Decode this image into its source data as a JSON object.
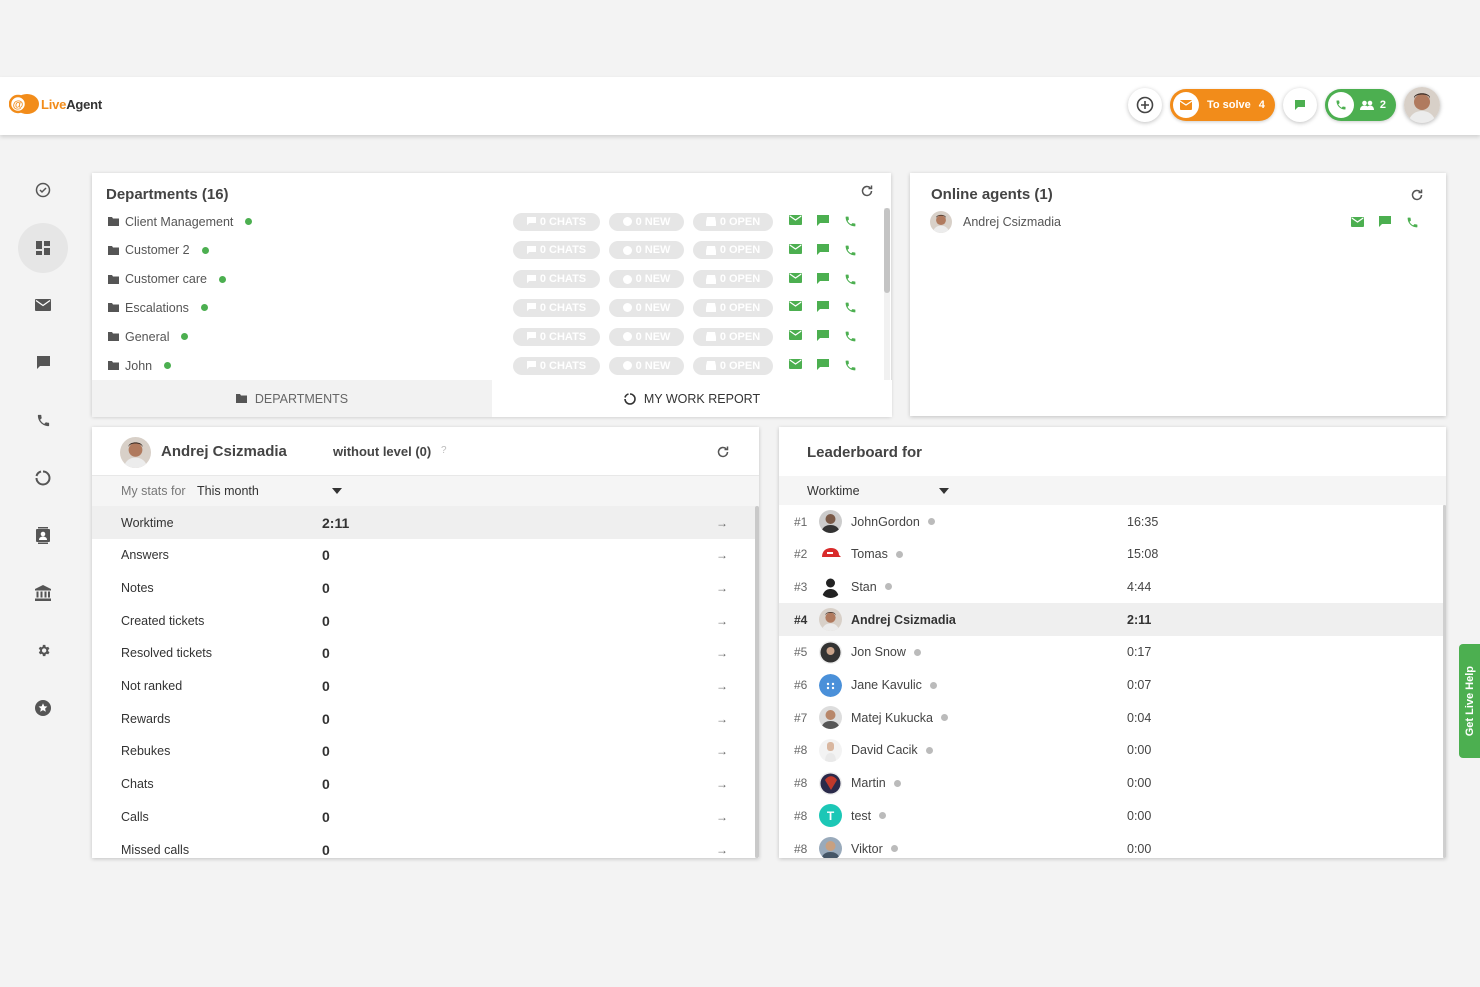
{
  "header": {
    "logo_live": "Live",
    "logo_agent": "Agent",
    "to_solve_label": "To solve",
    "to_solve_count": "4",
    "agents_online_count": "2"
  },
  "departments": {
    "title": "Departments (16)",
    "items": [
      {
        "name": "Client Management",
        "chats": "0 CHATS",
        "new": "0 NEW",
        "open": "0 OPEN"
      },
      {
        "name": "Customer 2",
        "chats": "0 CHATS",
        "new": "0 NEW",
        "open": "0 OPEN"
      },
      {
        "name": "Customer care",
        "chats": "0 CHATS",
        "new": "0 NEW",
        "open": "0 OPEN"
      },
      {
        "name": "Escalations",
        "chats": "0 CHATS",
        "new": "0 NEW",
        "open": "0 OPEN"
      },
      {
        "name": "General",
        "chats": "0 CHATS",
        "new": "0 NEW",
        "open": "0 OPEN"
      },
      {
        "name": "John",
        "chats": "0 CHATS",
        "new": "0 NEW",
        "open": "0 OPEN"
      }
    ],
    "tab_departments": "DEPARTMENTS",
    "tab_work_report": "MY WORK REPORT"
  },
  "online_agents": {
    "title": "Online agents (1)",
    "agents": [
      {
        "name": "Andrej Csizmadia"
      }
    ]
  },
  "my_stats": {
    "agent_name": "Andrej Csizmadia",
    "level": "without level (0)",
    "help_mark": "?",
    "stats_for_label": "My stats for",
    "period": "This month",
    "rows": [
      {
        "label": "Worktime",
        "value": "2:11"
      },
      {
        "label": "Answers",
        "value": "0"
      },
      {
        "label": "Notes",
        "value": "0"
      },
      {
        "label": "Created tickets",
        "value": "0"
      },
      {
        "label": "Resolved tickets",
        "value": "0"
      },
      {
        "label": "Not ranked",
        "value": "0"
      },
      {
        "label": "Rewards",
        "value": "0"
      },
      {
        "label": "Rebukes",
        "value": "0"
      },
      {
        "label": "Chats",
        "value": "0"
      },
      {
        "label": "Calls",
        "value": "0"
      },
      {
        "label": "Missed calls",
        "value": "0"
      }
    ]
  },
  "leaderboard": {
    "title": "Leaderboard for",
    "metric": "Worktime",
    "rows": [
      {
        "rank": "#1",
        "name": "JohnGordon",
        "value": "16:35"
      },
      {
        "rank": "#2",
        "name": "Tomas",
        "value": "15:08"
      },
      {
        "rank": "#3",
        "name": "Stan",
        "value": "4:44"
      },
      {
        "rank": "#4",
        "name": "Andrej Csizmadia",
        "value": "2:11"
      },
      {
        "rank": "#5",
        "name": "Jon Snow",
        "value": "0:17"
      },
      {
        "rank": "#6",
        "name": "Jane Kavulic",
        "value": "0:07"
      },
      {
        "rank": "#7",
        "name": "Matej Kukucka",
        "value": "0:04"
      },
      {
        "rank": "#8",
        "name": "David Cacik",
        "value": "0:00"
      },
      {
        "rank": "#8",
        "name": "Martin",
        "value": "0:00"
      },
      {
        "rank": "#8",
        "name": "test",
        "value": "0:00"
      },
      {
        "rank": "#8",
        "name": "Viktor",
        "value": "0:00"
      }
    ],
    "test_initial": "T"
  },
  "help_tab": "Get Live Help",
  "colors": {
    "brand_orange": "#f28c1a",
    "online_green": "#4caf50",
    "icon_gray": "#555555"
  }
}
